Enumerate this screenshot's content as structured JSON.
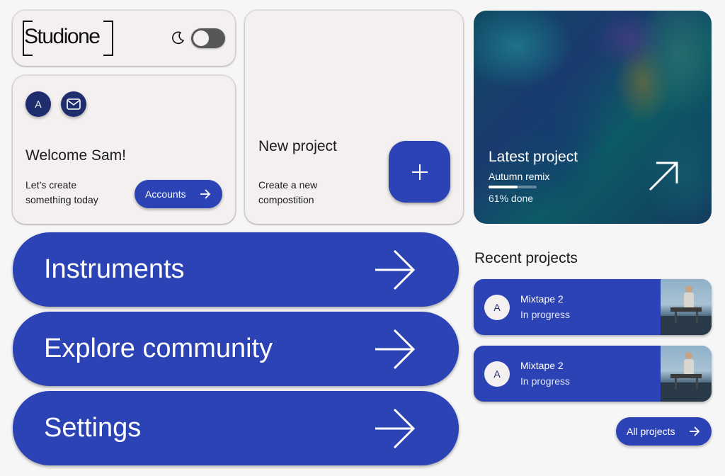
{
  "brand": {
    "logo_text": "Studione"
  },
  "theme": {
    "mode_icon": "moon-icon",
    "dark_mode_enabled": false
  },
  "welcome": {
    "avatar_initial": "A",
    "mail_icon": "mail-icon",
    "title": "Welcome Sam!",
    "subtitle": "Let’s create something today",
    "accounts_label": "Accounts"
  },
  "new_project": {
    "title": "New project",
    "subtitle": "Create a new compostition",
    "add_icon": "plus-icon"
  },
  "latest_project": {
    "title": "Latest project",
    "name": "Autumn remix",
    "progress": 0.61,
    "progress_text": "61% done",
    "open_icon": "arrow-up-right-icon"
  },
  "nav": [
    {
      "label": "Instruments",
      "icon": "arrow-right-icon"
    },
    {
      "label": "Explore community",
      "icon": "arrow-right-icon"
    },
    {
      "label": "Settings",
      "icon": "arrow-right-icon"
    }
  ],
  "recent": {
    "heading": "Recent projects",
    "items": [
      {
        "avatar_initial": "A",
        "name": "Mixtape 2",
        "status": "In progress"
      },
      {
        "avatar_initial": "A",
        "name": "Mixtape 2",
        "status": "In progress"
      }
    ],
    "all_label": "All projects"
  },
  "colors": {
    "accent": "#2b43b5",
    "navy": "#1f2c6e",
    "card": "#f3f0ef",
    "background": "#f7f6f6"
  }
}
